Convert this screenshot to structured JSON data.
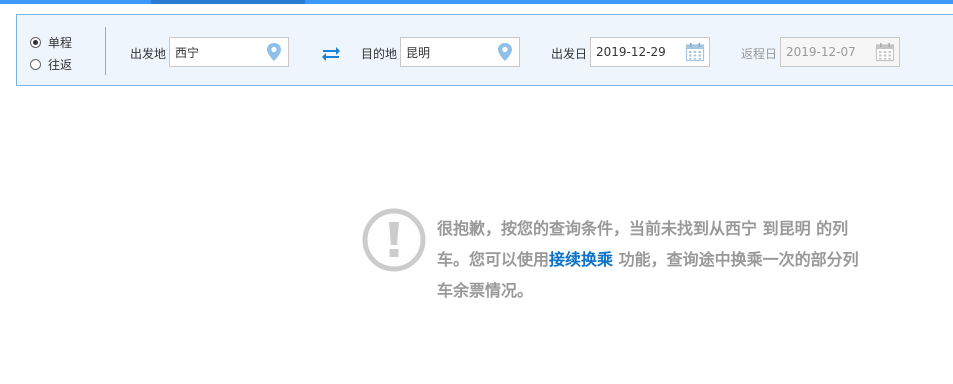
{
  "search": {
    "trip_types": [
      {
        "label": "单程",
        "selected": true
      },
      {
        "label": "往返",
        "selected": false
      }
    ],
    "from_label": "出发地",
    "from_value": "西宁",
    "to_label": "目的地",
    "to_value": "昆明",
    "depart_label": "出发日",
    "depart_value": "2019-12-29",
    "return_label": "返程日",
    "return_value": "2019-12-07"
  },
  "notice": {
    "text_before": "很抱歉，按您的查询条件，当前未找到从西宁 到昆明 的列车。您可以使用",
    "link_text": "接续换乘",
    "text_after": " 功能，查询途中换乘一次的部分列车余票情况。"
  },
  "colors": {
    "accent": "#3b99fc",
    "link": "#0b73c7",
    "notice_text": "#999999",
    "panel_bg": "#eef5fd",
    "panel_border": "#7ab3ea"
  },
  "icons": {
    "location": "map-pin-icon",
    "calendar": "calendar-icon",
    "swap": "swap-arrows-icon",
    "notice": "exclamation-circle-icon"
  }
}
